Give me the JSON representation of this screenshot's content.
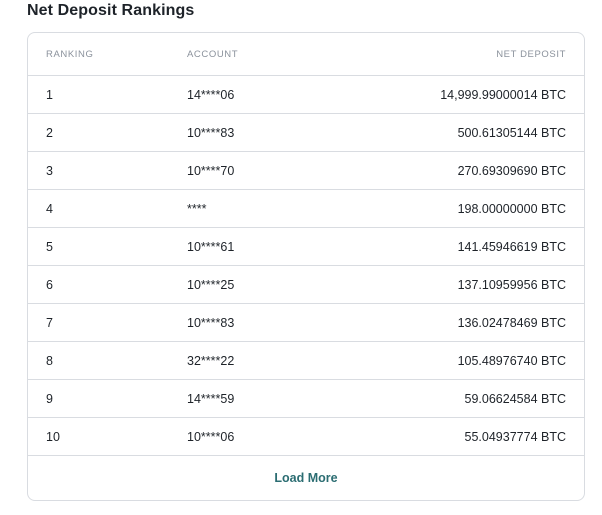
{
  "title": "Net Deposit Rankings",
  "table": {
    "headers": {
      "ranking": "RANKING",
      "account": "ACCOUNT",
      "net_deposit": "NET DEPOSIT"
    },
    "rows": [
      {
        "rank": "1",
        "account": "14****06",
        "net_deposit": "14,999.99000014 BTC"
      },
      {
        "rank": "2",
        "account": "10****83",
        "net_deposit": "500.61305144 BTC"
      },
      {
        "rank": "3",
        "account": "10****70",
        "net_deposit": "270.69309690 BTC"
      },
      {
        "rank": "4",
        "account": "****",
        "net_deposit": "198.00000000 BTC"
      },
      {
        "rank": "5",
        "account": "10****61",
        "net_deposit": "141.45946619 BTC"
      },
      {
        "rank": "6",
        "account": "10****25",
        "net_deposit": "137.10959956 BTC"
      },
      {
        "rank": "7",
        "account": "10****83",
        "net_deposit": "136.02478469 BTC"
      },
      {
        "rank": "8",
        "account": "32****22",
        "net_deposit": "105.48976740 BTC"
      },
      {
        "rank": "9",
        "account": "14****59",
        "net_deposit": "59.06624584 BTC"
      },
      {
        "rank": "10",
        "account": "10****06",
        "net_deposit": "55.04937774 BTC"
      }
    ],
    "load_more": "Load More"
  },
  "colors": {
    "accent": "#2b6d72",
    "border": "#d9dce1",
    "header_text": "#8b929c",
    "body_text": "#1e2329"
  }
}
